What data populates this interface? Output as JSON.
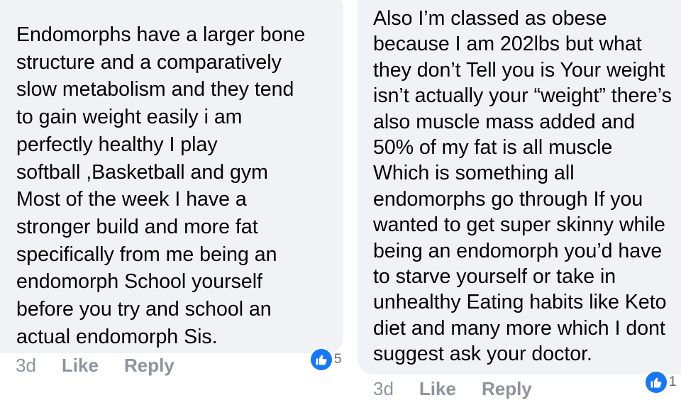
{
  "comments": [
    {
      "text": "Endomorphs have a larger bone\nstructure and a comparatively\nslow metabolism and they tend\nto gain weight easily i am\nperfectly healthy I play\nsoftball ,Basketball and gym\nMost of the week I have a\nstronger build and more fat\nspecifically from me being an\nendomorph School yourself\nbefore you try and school an\nactual endomorph Sis.",
      "time": "3d",
      "like_label": "Like",
      "reply_label": "Reply",
      "reaction_count": "5",
      "reaction_icon": "thumbs-up-icon"
    },
    {
      "text": "Also I’m classed as obese\nbecause I am 202lbs but what\nthey don’t Tell you is Your weight\nisn’t actually your “weight” there’s\nalso muscle mass added and\n50% of my fat is all muscle\nWhich is something all\nendomorphs go through If you\nwanted to get super skinny while\nbeing an endomorph you’d have\nto starve yourself or take in\nunhealthy Eating habits like Keto\ndiet and many more which I dont\nsuggest ask your doctor.",
      "time": "3d",
      "like_label": "Like",
      "reply_label": "Reply",
      "reaction_count": "1",
      "reaction_icon": "thumbs-up-icon"
    }
  ],
  "colors": {
    "bubble_bg": "#f1f2f6",
    "text": "#1c1e21",
    "meta": "#8d949e",
    "like_blue": "#1877f2"
  }
}
